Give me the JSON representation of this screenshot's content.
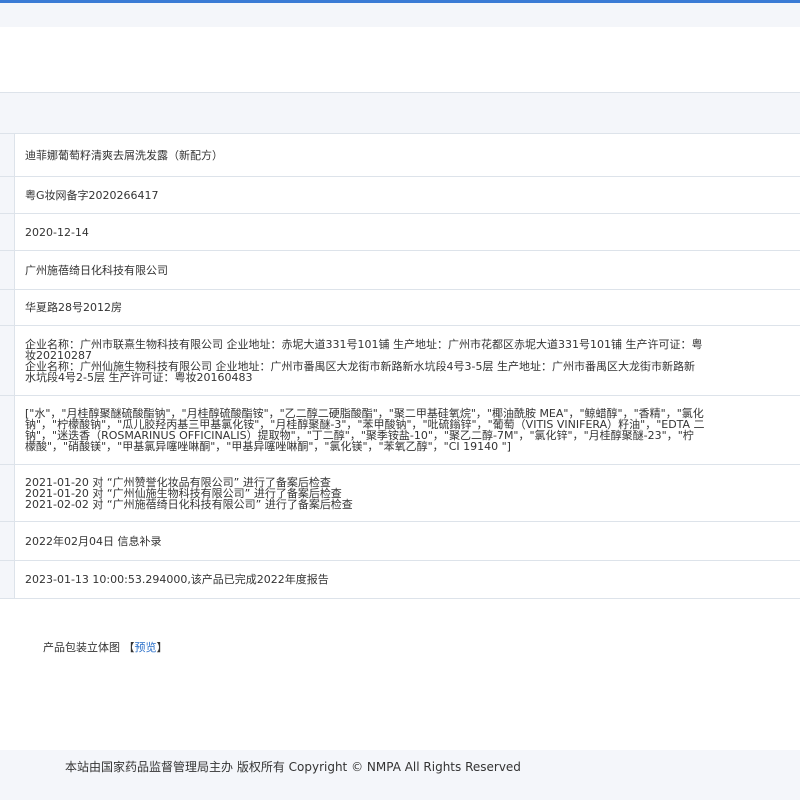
{
  "product": {
    "name": "迪菲娜葡萄籽清爽去屑洗发露（新配方）",
    "record_no": "粤G妆网备字2020266417",
    "record_date": "2020-12-14",
    "registrant": "广州施蓓绮日化科技有限公司",
    "address": "华夏路28号2012房",
    "manufacturers": [
      "企业名称：广州市联熹生物科技有限公司 企业地址：赤坭大道331号101铺 生产地址：广州市花都区赤坭大道331号101铺 生产许可证：粤",
      "妆20210287",
      "企业名称：广州仙施生物科技有限公司 企业地址：广州市番禺区大龙街市新路新水坑段4号3-5层 生产地址：广州市番禺区大龙街市新路新",
      "水坑段4号2-5层 生产许可证：粤妆20160483"
    ],
    "ingredients": [
      "[\"水\"，\"月桂醇聚醚硫酸酯钠\"，\"月桂醇硫酸酯铵\"，\"乙二醇二硬脂酸酯\"，\"聚二甲基硅氧烷\"，\"椰油酰胺 MEA\"，\"鲸蜡醇\"，\"香精\"，\"氯化",
      "钠\"，\"柠檬酸钠\"，\"瓜儿胶羟丙基三甲基氯化铵\"，\"月桂醇聚醚-3\"，\"苯甲酸钠\"，\"吡硫鎓锌\"，\"葡萄（VITIS VINIFERA）籽油\"，\"EDTA 二",
      "钠\"，\"迷迭香（ROSMARINUS OFFICINALIS）提取物\"，\"丁二醇\"，\"聚季铵盐-10\"，\"聚乙二醇-7M\"，\"氯化锌\"，\"月桂醇聚醚-23\"，\"柠",
      "檬酸\"，\"硝酸镁\"，\"甲基氯异噻唑啉酮\"，\"甲基异噻唑啉酮\"，\"氯化镁\"，\"苯氧乙醇\"，\"CI 19140 \"]"
    ],
    "inspections": [
      "2021-01-20 对 “广州赞誉化妆品有限公司” 进行了备案后检查",
      "2021-01-20 对 “广州仙施生物科技有限公司” 进行了备案后检查",
      "2021-02-02 对 “广州施蓓绮日化科技有限公司” 进行了备案后检查"
    ],
    "supplement": "2022年02月04日 信息补录",
    "annual_report": "2023-01-13 10:00:53.294000,该产品已完成2022年度报告"
  },
  "package": {
    "label": "产品包装立体图",
    "bracket_open": "【",
    "preview": "预览",
    "bracket_close": "】"
  },
  "footer": {
    "text": "本站由国家药品监督管理局主办 版权所有 Copyright © NMPA All Rights Reserved"
  }
}
